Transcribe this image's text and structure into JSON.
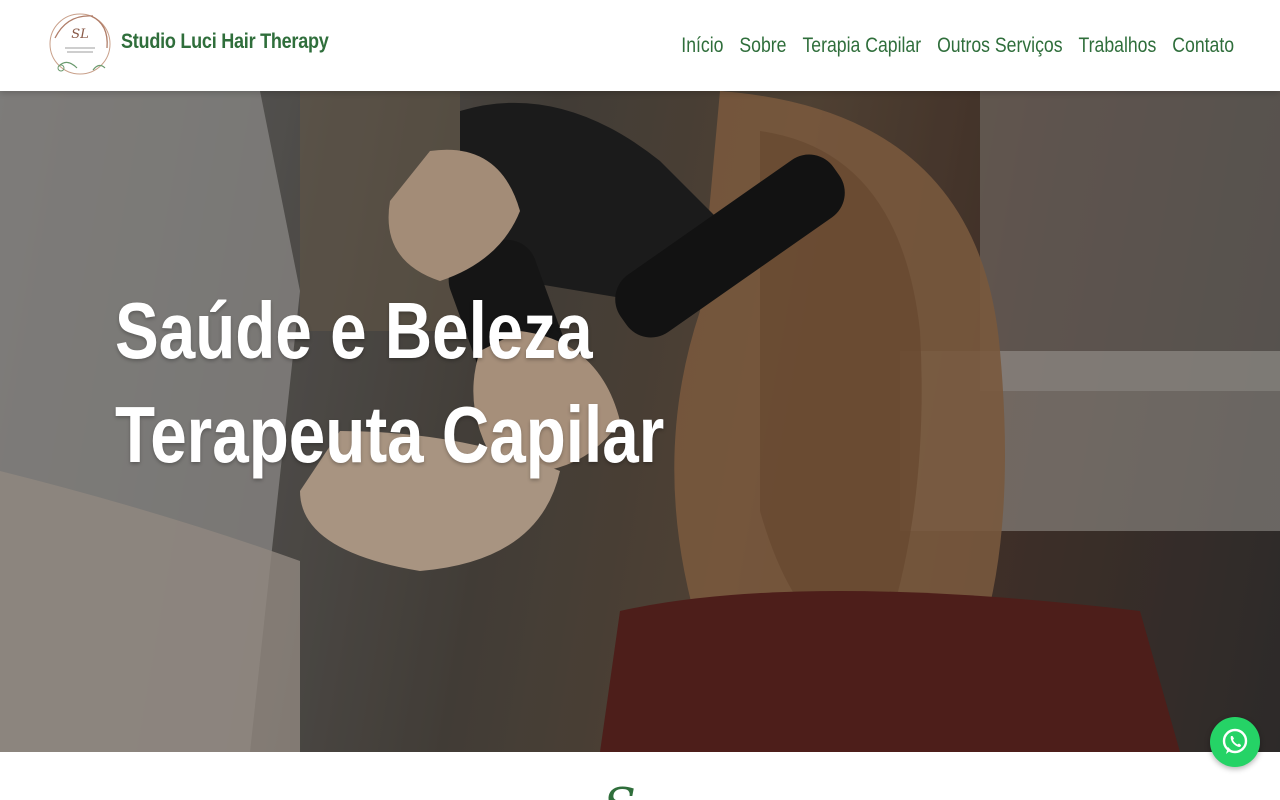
{
  "header": {
    "logo_alt": "SL Studio Luci Hair Therapy",
    "brand_name": "Studio Luci Hair Therapy",
    "nav": [
      "Início",
      "Sobre",
      "Terapia Capilar",
      "Outros Serviços",
      "Trabalhos",
      "Contato"
    ]
  },
  "hero": {
    "line1": "Saúde e Beleza",
    "line2": "Terapeuta Capilar"
  },
  "section": {
    "heading_partial": "S..."
  },
  "widgets": {
    "whatsapp_icon": "whatsapp-icon"
  },
  "colors": {
    "brand_green": "#2f6e3b",
    "whatsapp_green": "#25d366"
  }
}
